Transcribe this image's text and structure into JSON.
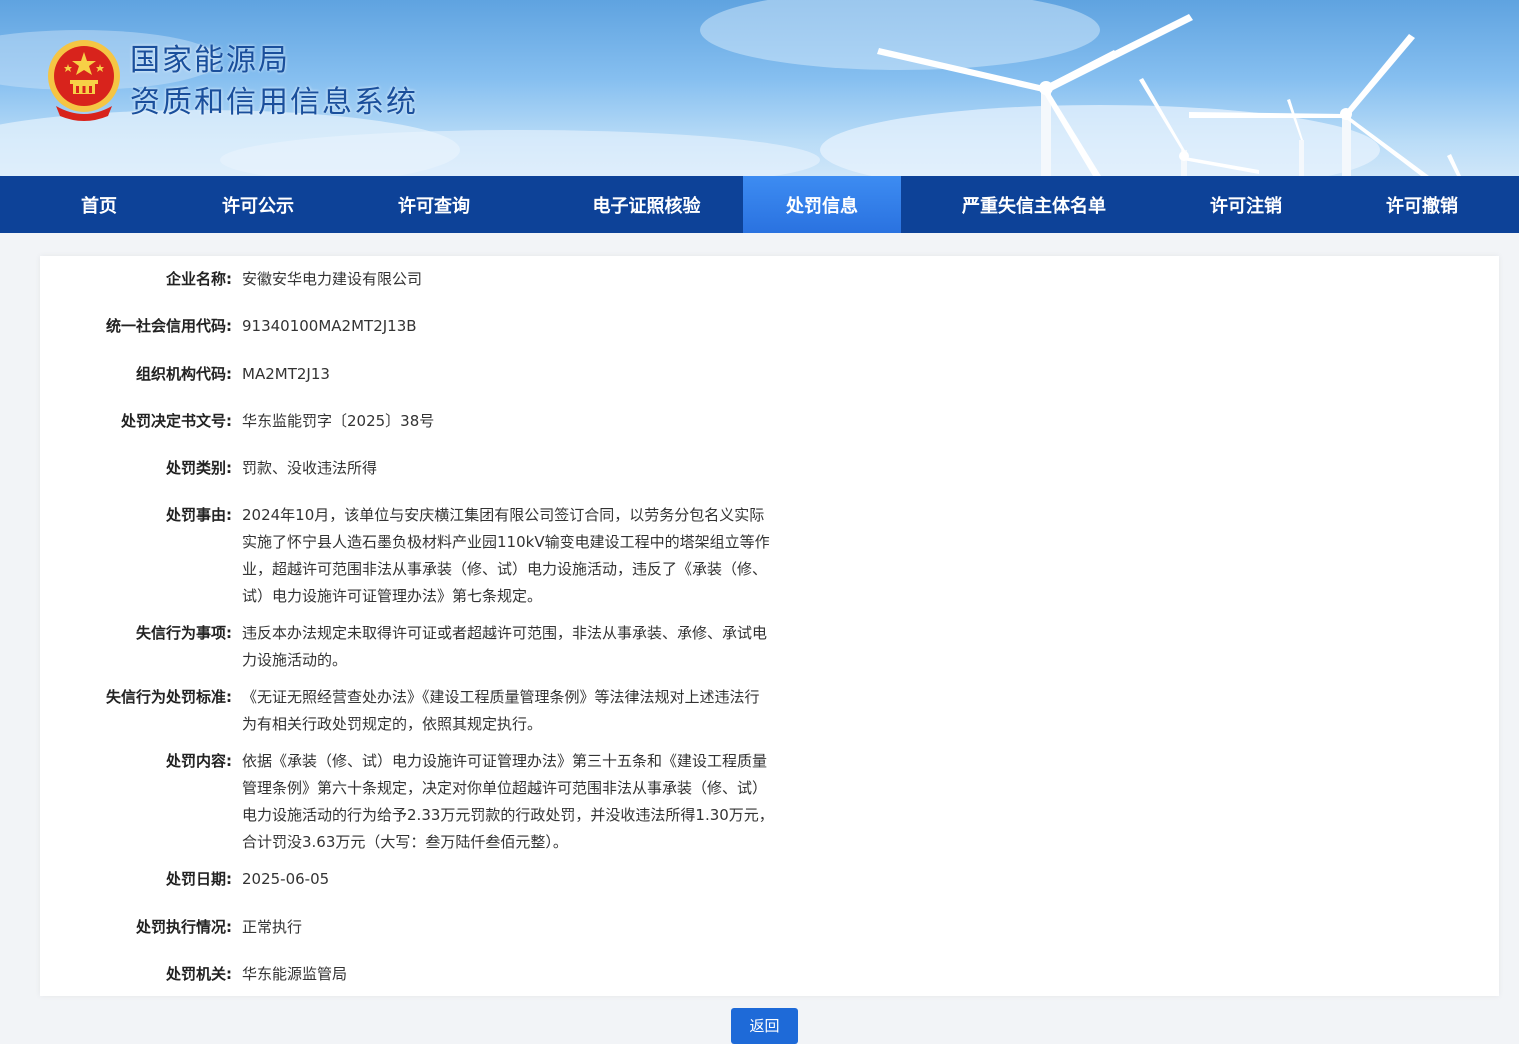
{
  "header": {
    "title_line1": "国家能源局",
    "title_line2": "资质和信用信息系统"
  },
  "nav": {
    "items": [
      {
        "label": "首页"
      },
      {
        "label": "许可公示"
      },
      {
        "label": "许可查询"
      },
      {
        "label": "电子证照核验"
      },
      {
        "label": "处罚信息",
        "active": true
      },
      {
        "label": "严重失信主体名单"
      },
      {
        "label": "许可注销"
      },
      {
        "label": "许可撤销"
      }
    ]
  },
  "detail": {
    "fields": [
      {
        "label": "企业名称:",
        "value": "安徽安华电力建设有限公司"
      },
      {
        "label": "统一社会信用代码:",
        "value": "91340100MA2MT2J13B"
      },
      {
        "label": "组织机构代码:",
        "value": "MA2MT2J13"
      },
      {
        "label": "处罚决定书文号:",
        "value": "华东监能罚字〔2025〕38号"
      },
      {
        "label": "处罚类别:",
        "value": "罚款、没收违法所得"
      },
      {
        "label": "处罚事由:",
        "value": "2024年10月，该单位与安庆横江集团有限公司签订合同，以劳务分包名义实际实施了怀宁县人造石墨负极材料产业园110kV输变电建设工程中的塔架组立等作业，超越许可范围非法从事承装（修、试）电力设施活动，违反了《承装（修、试）电力设施许可证管理办法》第七条规定。"
      },
      {
        "label": "失信行为事项:",
        "value": "违反本办法规定未取得许可证或者超越许可范围，非法从事承装、承修、承试电力设施活动的。"
      },
      {
        "label": "失信行为处罚标准:",
        "value": "《无证无照经营查处办法》《建设工程质量管理条例》等法律法规对上述违法行为有相关行政处罚规定的，依照其规定执行。"
      },
      {
        "label": "处罚内容:",
        "value": "依据《承装（修、试）电力设施许可证管理办法》第三十五条和《建设工程质量管理条例》第六十条规定，决定对你单位超越许可范围非法从事承装（修、试）电力设施活动的行为给予2.33万元罚款的行政处罚，并没收违法所得1.30万元，合计罚没3.63万元（大写：叁万陆仟叁佰元整）。"
      },
      {
        "label": "处罚日期:",
        "value": "2025-06-05"
      },
      {
        "label": "处罚执行情况:",
        "value": "正常执行"
      },
      {
        "label": "处罚机关:",
        "value": "华东能源监管局"
      }
    ]
  },
  "back_button": {
    "label": "返回"
  },
  "colors": {
    "nav_bg": "#0d4298",
    "nav_active": "#2a72e0",
    "button": "#1e6ad8"
  }
}
